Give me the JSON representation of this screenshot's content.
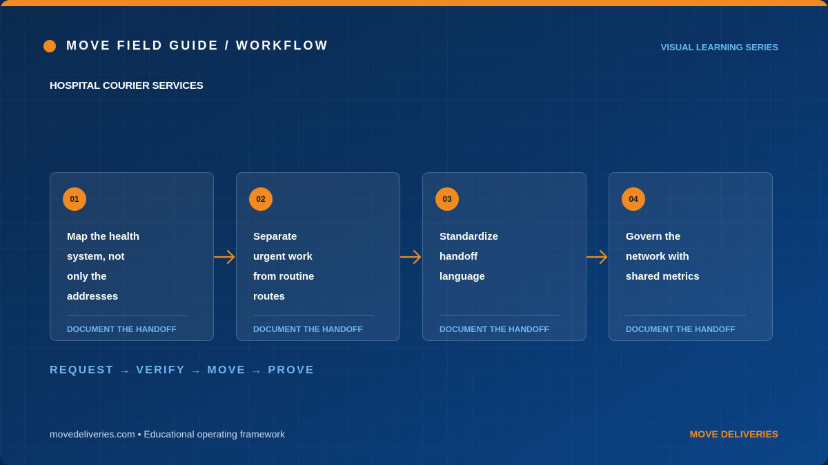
{
  "header": {
    "title": "MOVE FIELD GUIDE / WORKFLOW",
    "series_label": "VISUAL LEARNING SERIES"
  },
  "subtitle": "HOSPITAL COURIER SERVICES",
  "steps": [
    {
      "number": "01",
      "lines": [
        "Map the health",
        "system, not",
        "only the",
        "addresses"
      ],
      "footer": "DOCUMENT THE HANDOFF"
    },
    {
      "number": "02",
      "lines": [
        "Separate",
        "urgent work",
        "from routine",
        "routes"
      ],
      "footer": "DOCUMENT THE HANDOFF"
    },
    {
      "number": "03",
      "lines": [
        "Standardize",
        "handoff",
        "language"
      ],
      "footer": "DOCUMENT THE HANDOFF"
    },
    {
      "number": "04",
      "lines": [
        "Govern the",
        "network with",
        "shared metrics"
      ],
      "footer": "DOCUMENT THE HANDOFF"
    }
  ],
  "flow_line": "REQUEST → VERIFY → MOVE → PROVE",
  "footer": {
    "left": "movedeliveries.com • Educational operating framework",
    "right": "MOVE DELIVERIES"
  },
  "colors": {
    "accent": "#f28a23",
    "highlight_blue": "#6cb6f2",
    "background": "#0a3262"
  },
  "icons": {
    "connector": "arrow-right-icon",
    "header_marker": "orange-dot-icon"
  }
}
